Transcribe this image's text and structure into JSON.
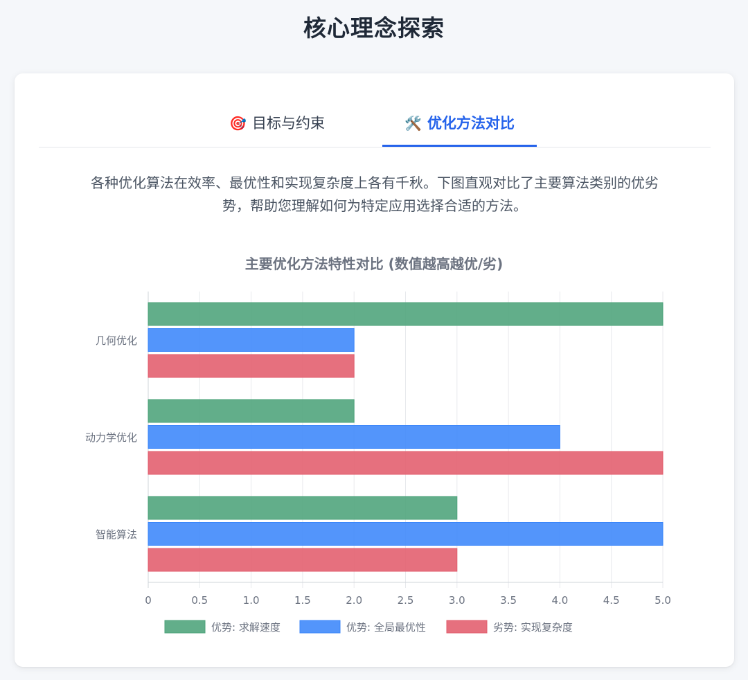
{
  "page": {
    "title": "核心理念探索"
  },
  "tabs": [
    {
      "icon": "🎯",
      "icon_name": "target-icon",
      "label": "目标与约束",
      "active": false
    },
    {
      "icon": "🛠️",
      "icon_name": "tools-icon",
      "label": "优化方法对比",
      "active": true
    }
  ],
  "intro": {
    "line1": "各种优化算法在效率、最优性和实现复杂度上各有千秋。下图直观对比了主要算法类别的优劣",
    "line2": "势，帮助您理解如何为特定应用选择合适的方法。"
  },
  "colors": {
    "accent": "#2563eb",
    "speed": "#4ca37a",
    "optimality": "#3b86fa",
    "complexity": "#e25c6c"
  },
  "chart_data": {
    "type": "bar",
    "orientation": "horizontal",
    "title": "主要优化方法特性对比 (数值越高越优/劣)",
    "categories": [
      "几何优化",
      "动力学优化",
      "智能算法"
    ],
    "series": [
      {
        "name": "优势: 求解速度",
        "values": [
          5,
          2,
          3
        ],
        "color": "#4ca37a"
      },
      {
        "name": "优势: 全局最优性",
        "values": [
          2,
          4,
          5
        ],
        "color": "#3b86fa"
      },
      {
        "name": "劣势: 实现复杂度",
        "values": [
          2,
          5,
          3
        ],
        "color": "#e25c6c"
      }
    ],
    "xlim": [
      0,
      5
    ],
    "xticks": [
      "0",
      "0.5",
      "1.0",
      "1.5",
      "2.0",
      "2.5",
      "3.0",
      "3.5",
      "4.0",
      "4.5",
      "5.0"
    ],
    "grid": true,
    "legend": "bottom"
  }
}
